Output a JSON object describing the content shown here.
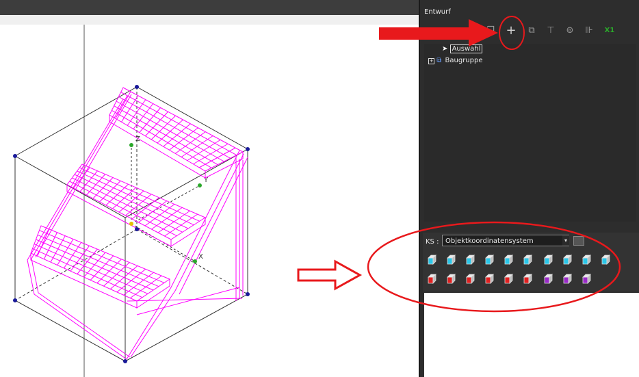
{
  "panel": {
    "title": "Entwurf",
    "toolbar_icons": [
      "open-icon",
      "cut-icon",
      "copy-icon",
      "add-icon",
      "paste-icon",
      "tree-icon",
      "component-icon",
      "align-icon",
      "x-icon"
    ],
    "toolbar_x_label": "X1"
  },
  "tree": {
    "items": [
      {
        "label": "Auswahl",
        "selected": true,
        "icon": "cursor-icon"
      },
      {
        "label": "Baugruppe",
        "selected": false,
        "icon": "assembly-icon"
      }
    ]
  },
  "ks": {
    "label": "KS :",
    "value": "Objektkoordinatensystem"
  },
  "colors": {
    "accent_red": "#e8191c",
    "wireframe": "#ff00ff",
    "cyan": "#29c6e8",
    "red": "#e02020",
    "purple": "#9a2ac8"
  }
}
